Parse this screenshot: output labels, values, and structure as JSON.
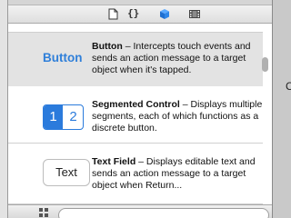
{
  "toolbar": {
    "tabs": [
      {
        "icon": "file-template-icon"
      },
      {
        "icon": "code-snippet-icon",
        "label": "{}"
      },
      {
        "icon": "object-library-icon"
      },
      {
        "icon": "media-library-icon"
      }
    ]
  },
  "library": {
    "items": [
      {
        "sample": "Button",
        "title": "Button",
        "description": " – Intercepts touch events and sends an action message to a target object when it's tapped."
      },
      {
        "sample_segments": [
          "1",
          "2"
        ],
        "title": "Segmented Control",
        "description": " – Displays multiple segments, each of which functions as a discrete button."
      },
      {
        "sample": "Text",
        "title": "Text Field",
        "description": " – Displays editable text and sends an action message to a target object when Return..."
      }
    ]
  },
  "canvas": {
    "partial_text": "C"
  },
  "colors": {
    "accent": "#2b7bdc",
    "selected_row": "#e3e3e3"
  }
}
